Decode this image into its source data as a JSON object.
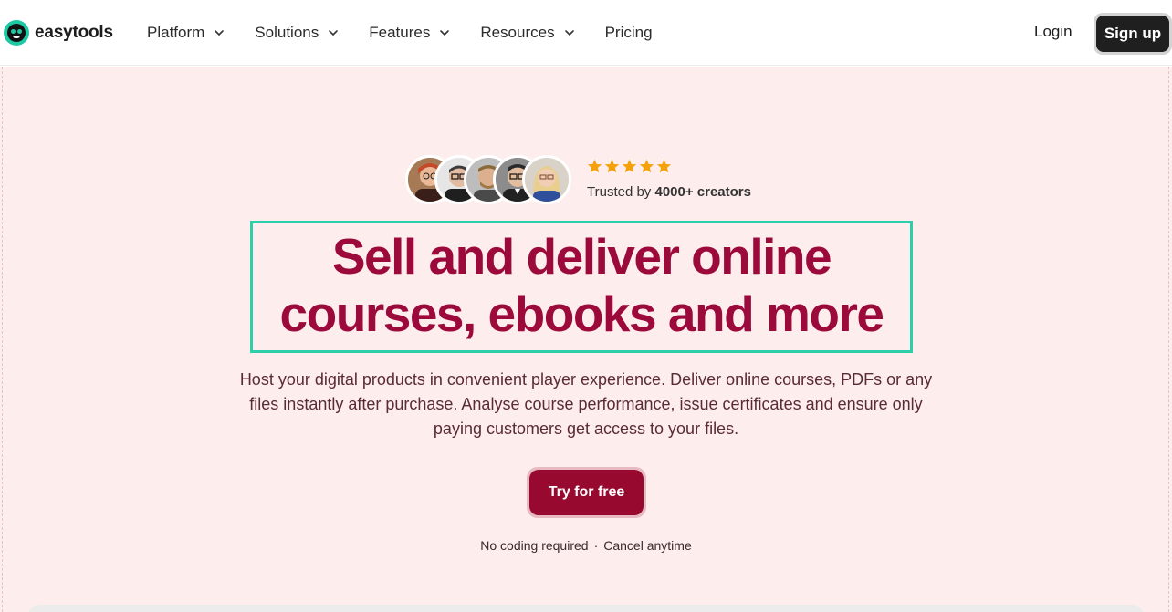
{
  "brand": {
    "name": "easytools",
    "accent": "#1cc9a3"
  },
  "nav": {
    "items": [
      {
        "label": "Platform",
        "has_dropdown": true
      },
      {
        "label": "Solutions",
        "has_dropdown": true
      },
      {
        "label": "Features",
        "has_dropdown": true
      },
      {
        "label": "Resources",
        "has_dropdown": true
      },
      {
        "label": "Pricing",
        "has_dropdown": false
      }
    ],
    "login_label": "Login",
    "signup_label": "Sign up"
  },
  "hero": {
    "rating_stars": 5,
    "trusted_prefix": "Trusted by ",
    "trusted_count": "4000+ creators",
    "headline_line1": "Sell and deliver online",
    "headline_line2": "courses, ebooks and more",
    "subtitle": "Host your digital products in convenient player experience. Deliver online courses, PDFs or any files instantly after purchase. Analyse course performance, issue certificates and ensure only paying customers get access to your files.",
    "cta_label": "Try for free",
    "note_left": "No coding required",
    "note_sep": "·",
    "note_right": "Cancel anytime",
    "headline_color": "#9c0a3c",
    "background_color": "#fdeeed",
    "highlight_border_color": "#2ccfa8",
    "star_color": "#f5a10a"
  }
}
